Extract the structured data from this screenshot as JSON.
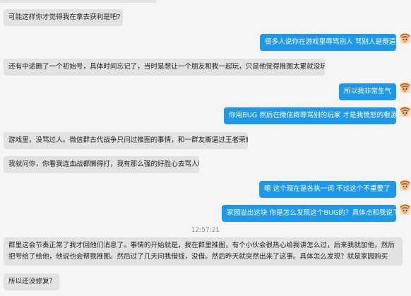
{
  "messages": [
    {
      "side": "in",
      "text": "可能这样你才觉得我在拿去获利是吧?"
    },
    {
      "side": "out",
      "text": "很多人说你在游戏里辱骂别人 骂别人是傻逼"
    },
    {
      "side": "in",
      "text": "还有中途删了一个初始号，具体时间忘记了，当时是想让一个朋友和我一起玩，只是他觉得推图太累就没玩了。"
    },
    {
      "side": "out",
      "text": "所以我非常生气"
    },
    {
      "side": "out",
      "text": "你用BUG  然后在微信群辱骂别的玩家  才是我愤怒的根源"
    },
    {
      "side": "in",
      "text": "游戏里，没骂过人。微信群古代战争只问过推图的事情，和一群友撕逼过王者荣耀"
    },
    {
      "side": "in",
      "text": "我就问你，你看我连血战都懒得打，我有那么强的好胜心去骂人吗"
    },
    {
      "side": "out",
      "text": "嗯  这个现在是各执一词  不过这个不重要了"
    },
    {
      "side": "out",
      "text": "家园溢出这块  你是怎么发现这个BUG的？具体点和我说下"
    },
    {
      "side": "in",
      "text": "群里这会节奏正常了我才回他们消息了。事情的开始就是，我在群里推图，有个小伙会很热心给我讲怎么过，后来我就加他，然后把号给了给他，他说也会帮我推图。然后过了几天问我借钱，没借。然后昨天就突然出来了这事。具体怎么发现？就是家园购买"
    },
    {
      "side": "in",
      "text": "所以还没修复？"
    }
  ],
  "timestamp": "12:57:21",
  "colors": {
    "background": "#f5f5f5",
    "incoming_bubble": "#e2e2e2",
    "outgoing_bubble": "#1e98e9",
    "outgoing_text": "#ffffff",
    "incoming_text": "#222222"
  },
  "icons": {
    "avatar": "cartoon-avatar-icon"
  }
}
